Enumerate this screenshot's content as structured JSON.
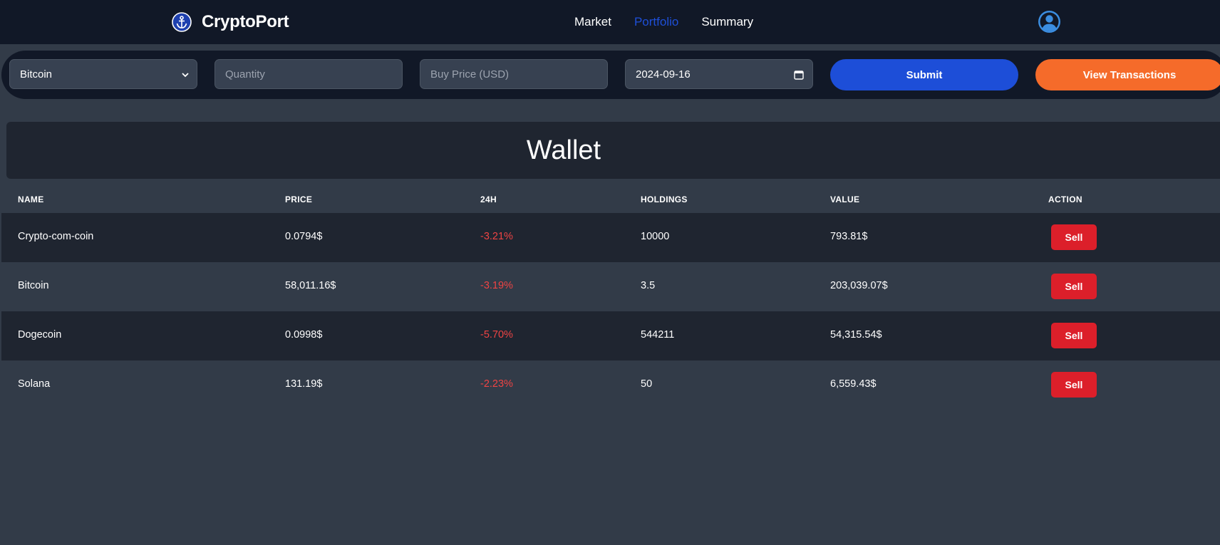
{
  "navbar": {
    "brand": "CryptoPort",
    "brand_icon": "anchor-icon",
    "links": [
      {
        "label": "Market",
        "active": false
      },
      {
        "label": "Portfolio",
        "active": true
      },
      {
        "label": "Summary",
        "active": false
      }
    ],
    "avatar_icon": "user-avatar-icon"
  },
  "form": {
    "coin_select_value": "Bitcoin",
    "quantity_placeholder": "Quantity",
    "buy_price_placeholder": "Buy Price (USD)",
    "date_value": "2024-09-16",
    "submit_label": "Submit",
    "view_transactions_label": "View Transactions"
  },
  "wallet": {
    "title": "Wallet",
    "columns": [
      "NAME",
      "PRICE",
      "24H",
      "HOLDINGS",
      "VALUE",
      "ACTION"
    ],
    "rows": [
      {
        "name": "Crypto-com-coin",
        "price": "0.0794$",
        "change": "-3.21%",
        "holdings": "10000",
        "value": "793.81$",
        "action": "Sell"
      },
      {
        "name": "Bitcoin",
        "price": "58,011.16$",
        "change": "-3.19%",
        "holdings": "3.5",
        "value": "203,039.07$",
        "action": "Sell"
      },
      {
        "name": "Dogecoin",
        "price": "0.0998$",
        "change": "-5.70%",
        "holdings": "544211",
        "value": "54,315.54$",
        "action": "Sell"
      },
      {
        "name": "Solana",
        "price": "131.19$",
        "change": "-2.23%",
        "holdings": "50",
        "value": "6,559.43$",
        "action": "Sell"
      }
    ]
  },
  "colors": {
    "page_bg": "#323b48",
    "navbar_bg": "#111827",
    "active_link": "#1e4fd8",
    "submit_btn": "#1d4ed8",
    "view_btn": "#f56b2a",
    "sell_btn": "#dc1f2a",
    "negative": "#ef4444"
  }
}
